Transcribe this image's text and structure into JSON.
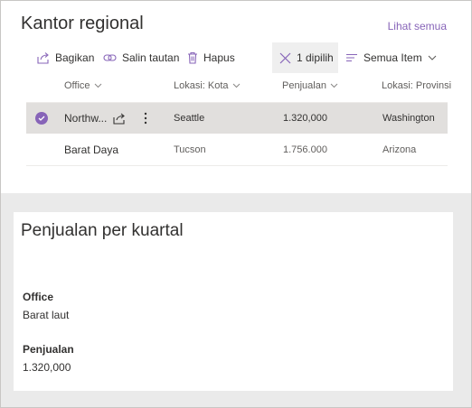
{
  "webpart_list": {
    "title": "Kantor regional",
    "see_all": "Lihat semua",
    "toolbar": {
      "share": "Bagikan",
      "copy_link": "Salin tautan",
      "delete": "Hapus",
      "selected": "1 dipilih",
      "view": "Semua Item"
    },
    "columns": [
      "Office",
      "Lokasi: Kota",
      "Penjualan",
      "Lokasi: Provinsi"
    ],
    "rows": [
      {
        "office": "Northw...",
        "city": "Seattle",
        "sales": "1.320,000",
        "province": "Washington",
        "selected": true
      },
      {
        "office": "Barat Daya",
        "city": "Tucson",
        "sales": "1.756.000",
        "province": "Arizona",
        "selected": false
      }
    ]
  },
  "webpart_detail": {
    "title": "Penjualan per kuartal",
    "fields": [
      {
        "label": "Office",
        "value": "Barat laut"
      },
      {
        "label": "Penjualan",
        "value": "1.320,000"
      }
    ]
  },
  "colors": {
    "accent": "#8764b8",
    "selected_row": "#e1dfdd",
    "canvas": "#eaeaea"
  }
}
